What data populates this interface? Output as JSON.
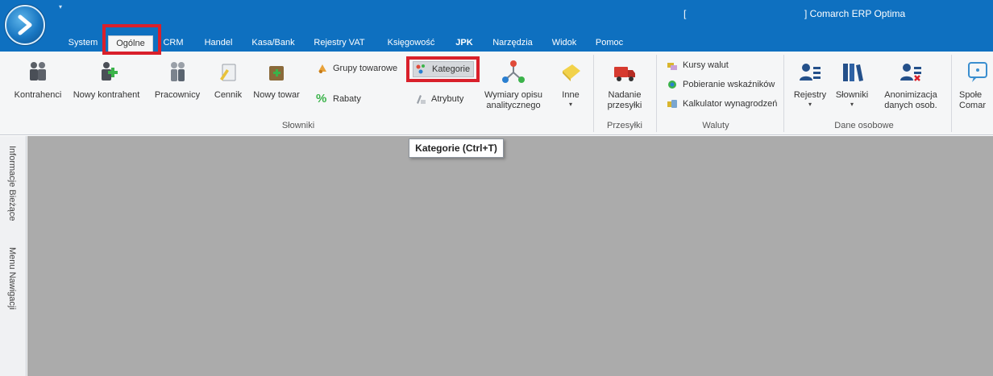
{
  "window": {
    "title_left": "[",
    "title_right": "] Comarch ERP Optima"
  },
  "tabs": [
    {
      "label": "System"
    },
    {
      "label": "Ogólne"
    },
    {
      "label": "CRM"
    },
    {
      "label": "Handel"
    },
    {
      "label": "Kasa/Bank"
    },
    {
      "label": "Rejestry VAT"
    },
    {
      "label": "Księgowość"
    },
    {
      "label": "JPK"
    },
    {
      "label": "Narzędzia"
    },
    {
      "label": "Widok"
    },
    {
      "label": "Pomoc"
    }
  ],
  "ribbon": {
    "slowniki": {
      "label": "Słowniki",
      "kontrahenci": "Kontrahenci",
      "nowy_kontrahent": "Nowy kontrahent",
      "pracownicy": "Pracownicy",
      "cennik": "Cennik",
      "nowy_towar": "Nowy towar",
      "grupy_towarowe": "Grupy towarowe",
      "rabaty": "Rabaty",
      "kategorie": "Kategorie",
      "atrybuty": "Atrybuty",
      "wymiary_line1": "Wymiary opisu",
      "wymiary_line2": "analitycznego",
      "inne": "Inne"
    },
    "przesylki": {
      "label": "Przesyłki",
      "nadanie_line1": "Nadanie",
      "nadanie_line2": "przesyłki"
    },
    "waluty": {
      "label": "Waluty",
      "kursy": "Kursy walut",
      "pobieranie": "Pobieranie wskaźników",
      "kalkulator": "Kalkulator wynagrodzeń"
    },
    "dane_osobowe": {
      "label": "Dane osobowe",
      "rejestry": "Rejestry",
      "slowniki": "Słowniki",
      "anonimizacja_line1": "Anonimizacja",
      "anonimizacja_line2": "danych osob."
    },
    "spolecznosc": {
      "line1": "Społe",
      "line2": "Comar"
    }
  },
  "tooltip": {
    "text": "Kategorie (Ctrl+T)"
  },
  "sidepanel": {
    "informacje": "Informacje Bieżące",
    "menu": "Menu Nawigacji"
  },
  "colors": {
    "titlebar": "#0e70c0",
    "highlight_frame": "#d9202b",
    "workarea": "#ababab"
  }
}
